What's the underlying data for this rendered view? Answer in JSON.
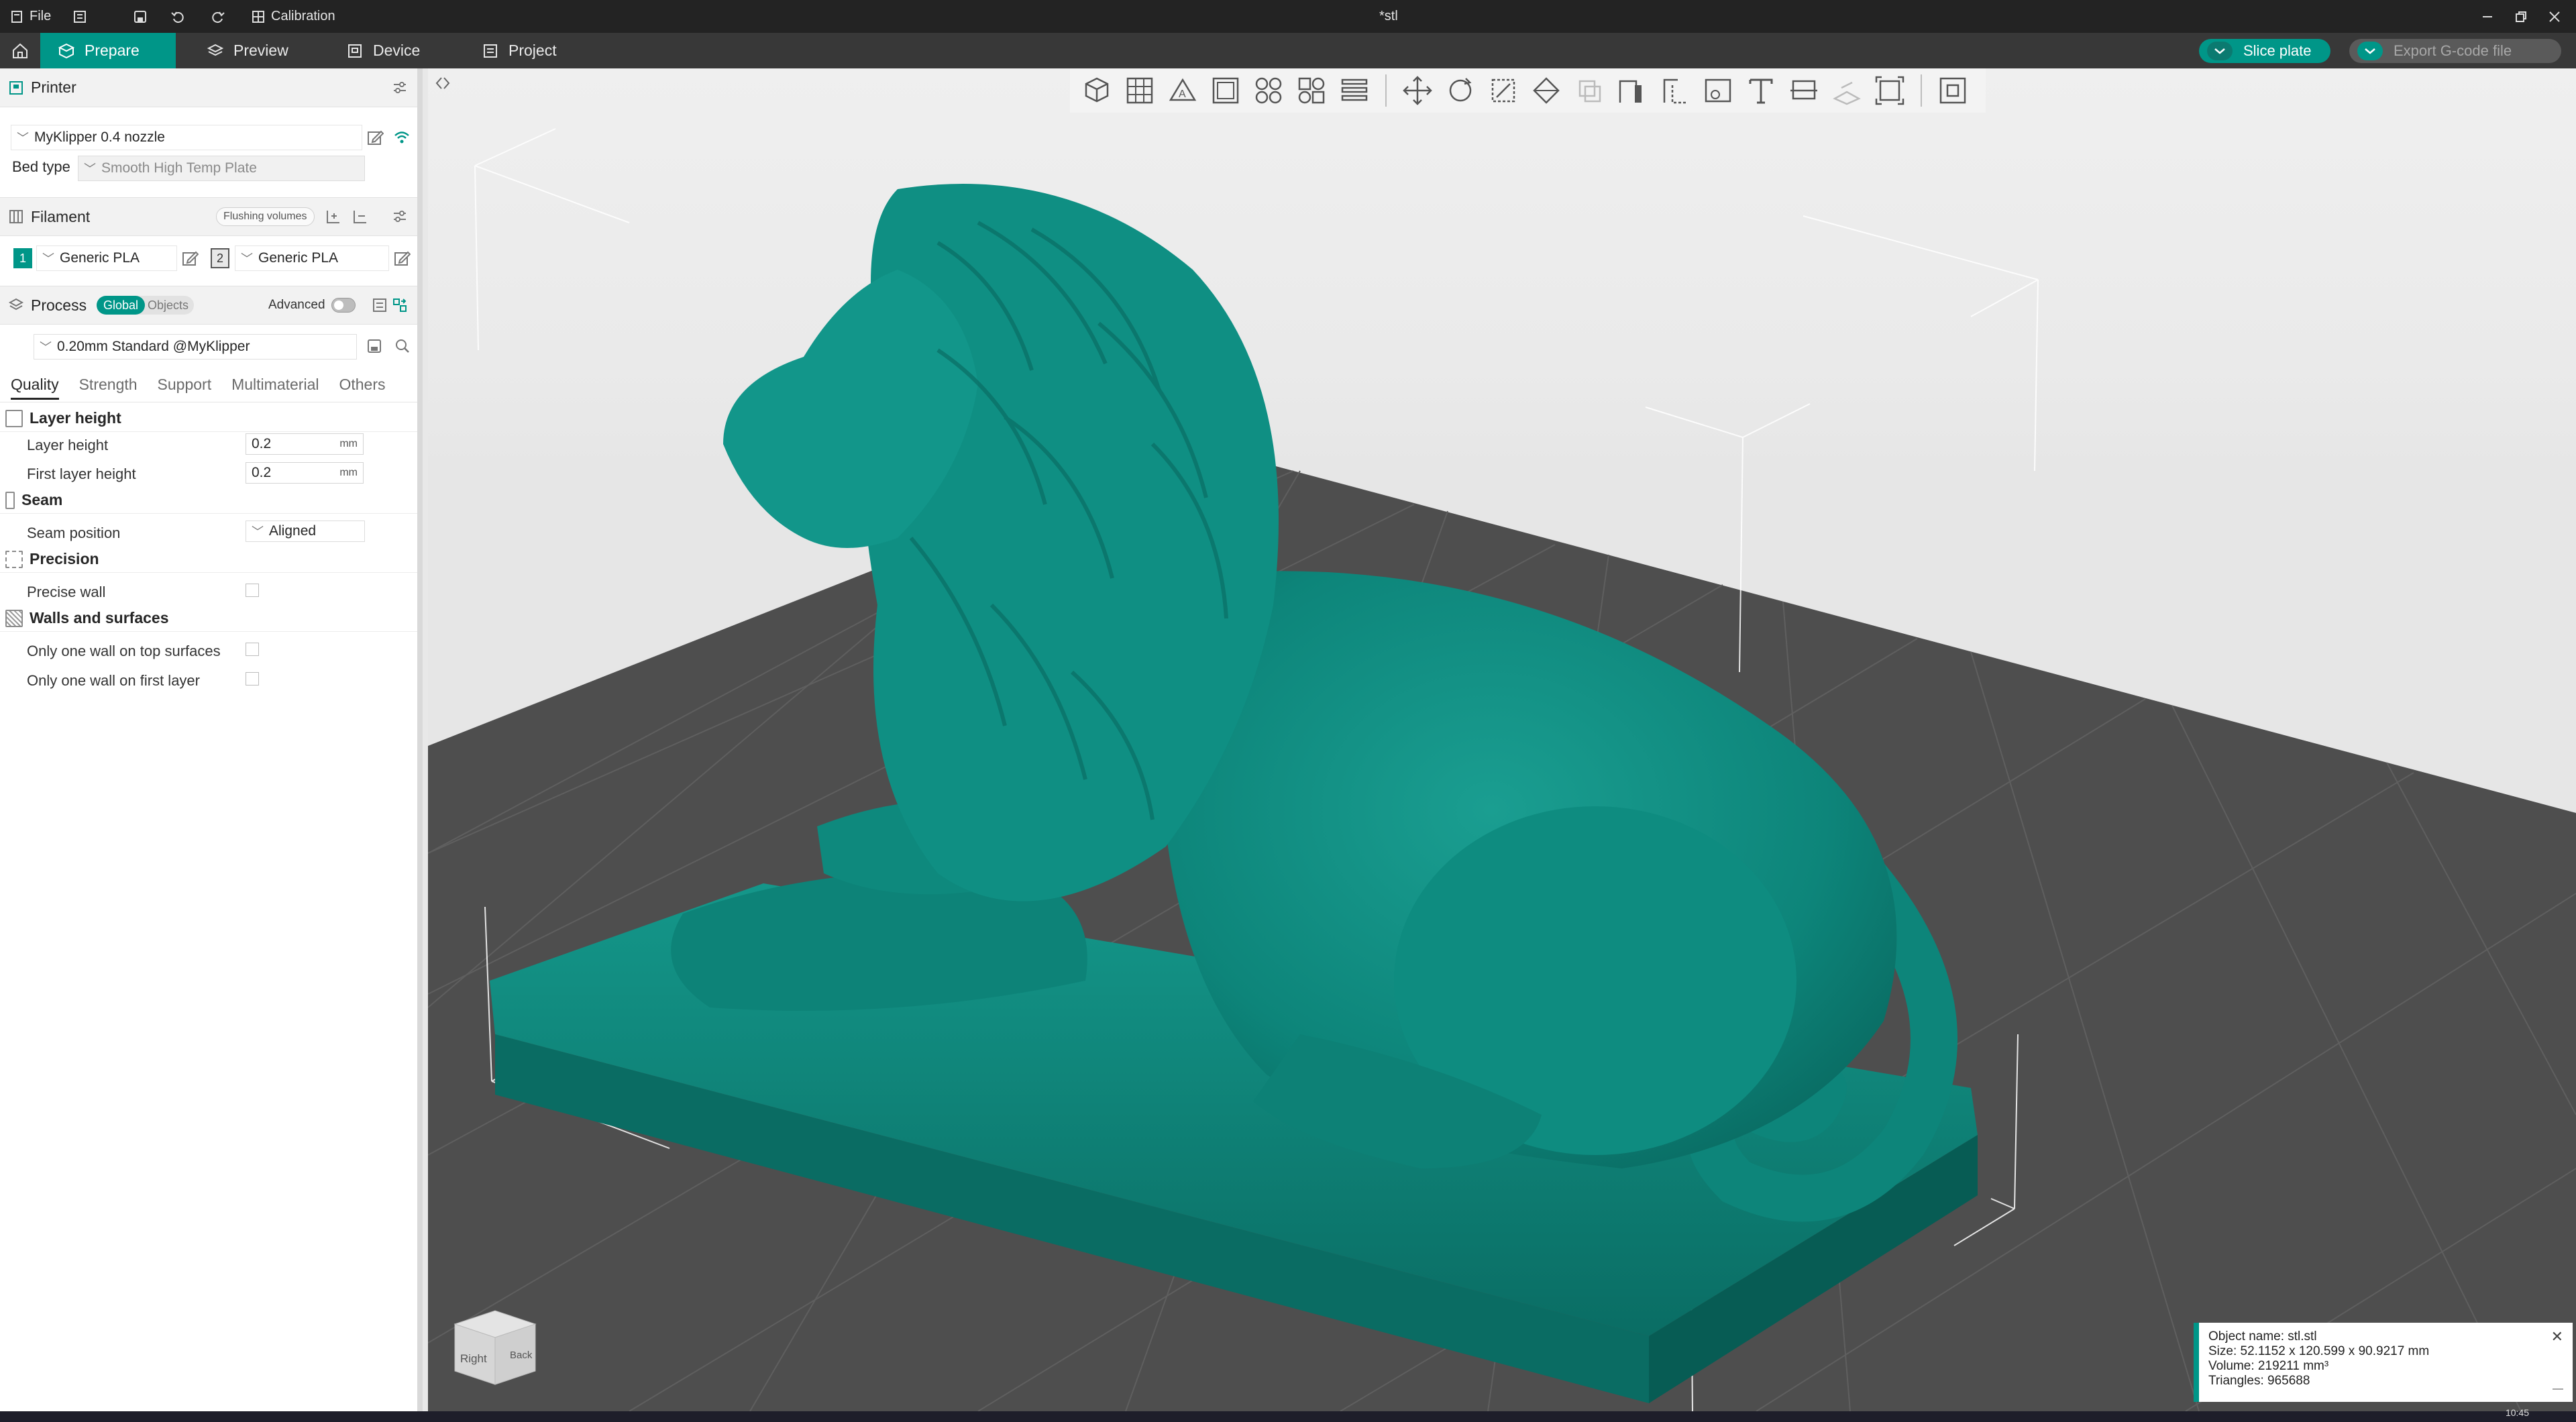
{
  "titlebar": {
    "menu_file": "File",
    "calibration": "Calibration",
    "doc_title": "*stl"
  },
  "navbar": {
    "tabs": [
      {
        "label": "Prepare",
        "icon": "cube-icon"
      },
      {
        "label": "Preview",
        "icon": "layers-icon"
      },
      {
        "label": "Device",
        "icon": "device-icon"
      },
      {
        "label": "Project",
        "icon": "project-icon"
      }
    ],
    "slice_label": "Slice plate",
    "export_label": "Export G-code file"
  },
  "printer": {
    "section_title": "Printer",
    "name": "MyKlipper 0.4 nozzle",
    "bed_type_label": "Bed type",
    "bed_type_value": "Smooth High Temp Plate"
  },
  "filament": {
    "section_title": "Filament",
    "flushing_label": "Flushing volumes",
    "slots": [
      {
        "index": "1",
        "name": "Generic PLA"
      },
      {
        "index": "2",
        "name": "Generic PLA"
      }
    ]
  },
  "process": {
    "section_title": "Process",
    "toggle_global": "Global",
    "toggle_objects": "Objects",
    "advanced_label": "Advanced",
    "preset": "0.20mm Standard @MyKlipper",
    "tabs": [
      "Quality",
      "Strength",
      "Support",
      "Multimaterial",
      "Others"
    ],
    "groups": {
      "layer_height": {
        "title": "Layer height",
        "layer_height_label": "Layer height",
        "layer_height_value": "0.2",
        "first_layer_label": "First layer height",
        "first_layer_value": "0.2",
        "unit": "mm"
      },
      "seam": {
        "title": "Seam",
        "position_label": "Seam position",
        "position_value": "Aligned"
      },
      "precision": {
        "title": "Precision",
        "precise_wall_label": "Precise wall"
      },
      "walls": {
        "title": "Walls and surfaces",
        "top_label": "Only one wall on top surfaces",
        "first_layer_label": "Only one wall on first layer"
      }
    }
  },
  "viewcube": {
    "right": "Right",
    "back": "Back"
  },
  "object_info": {
    "name": "Object name: stl.stl",
    "size": "Size: 52.1152 x 120.599 x 90.9217 mm",
    "volume": "Volume: 219211 mm³",
    "triangles": "Triangles: 965688"
  },
  "colors": {
    "accent": "#009688",
    "model": "#0f8f83",
    "plate": "#4d4d4d"
  },
  "taskbar": {
    "clock": "10:45"
  }
}
